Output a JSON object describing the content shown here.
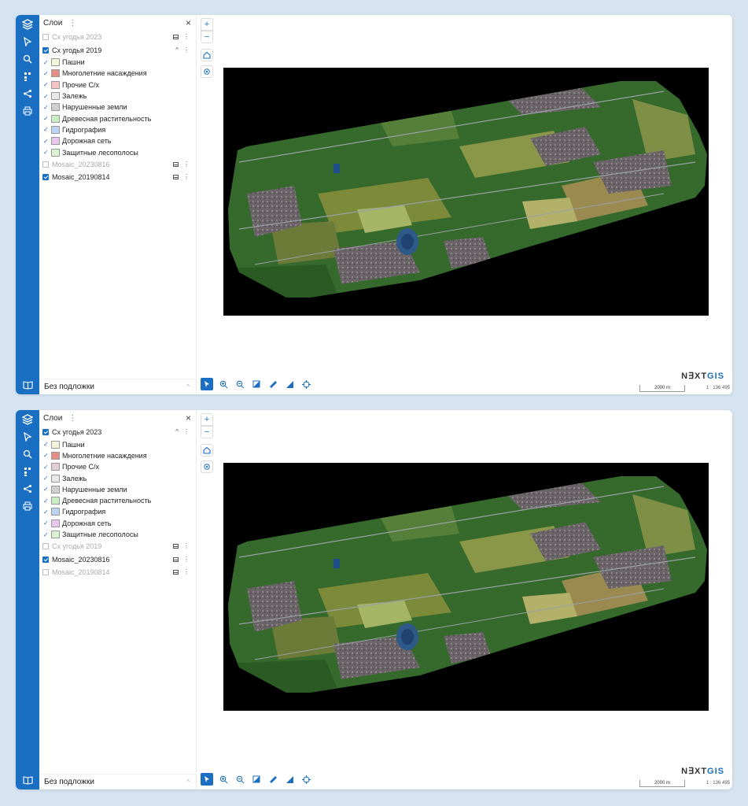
{
  "colors": {
    "accent": "#1a6fc2",
    "rail": "#1a6fc2",
    "map_bg": "#000000"
  },
  "panels": [
    {
      "layers_title": "Слои",
      "rows": [
        {
          "type": "group",
          "label": "Сх угодья 2023",
          "checked": false,
          "dim": true,
          "icons": [
            "table-icon",
            "more-icon"
          ]
        },
        {
          "type": "group",
          "label": "Сх угодья 2019",
          "checked": true,
          "dim": false,
          "icons": [
            "collapse-icon",
            "more-icon"
          ]
        },
        {
          "type": "class",
          "label": "Пашни",
          "color": "#f3f6d8"
        },
        {
          "type": "class",
          "label": "Многолетние насаждения",
          "color": "#e48e86"
        },
        {
          "type": "class",
          "label": "Прочие С/х",
          "color": "#f4c4c4"
        },
        {
          "type": "class",
          "label": "Залежь",
          "color": "#e8e8e8"
        },
        {
          "type": "class",
          "label": "Нарушенные земли",
          "color": "#d8d8d8"
        },
        {
          "type": "class",
          "label": "Древесная растительность",
          "color": "#c7efc2"
        },
        {
          "type": "class",
          "label": "Гидрография",
          "color": "#bcd4f4"
        },
        {
          "type": "class",
          "label": "Дорожная сеть",
          "color": "#e8c6ee"
        },
        {
          "type": "class",
          "label": "Защитные лесополосы",
          "color": "#d8f2d2"
        },
        {
          "type": "group",
          "label": "Mosaic_20230816",
          "checked": false,
          "dim": true,
          "icons": [
            "table-icon",
            "more-icon"
          ]
        },
        {
          "type": "group",
          "label": "Mosaic_20190814",
          "checked": true,
          "dim": false,
          "icons": [
            "table-icon",
            "more-icon"
          ]
        }
      ],
      "basemap": "Без подложки",
      "scale_label": "2000 m",
      "ratio_label": "1 : 136 495",
      "logo_a": "N∃XT",
      "logo_b": "GIS"
    },
    {
      "layers_title": "Слои",
      "rows": [
        {
          "type": "group",
          "label": "Сх угодья 2023",
          "checked": true,
          "dim": false,
          "icons": [
            "collapse-icon",
            "more-icon"
          ]
        },
        {
          "type": "class",
          "label": "Пашни",
          "color": "#f3f6d8"
        },
        {
          "type": "class",
          "label": "Многолетние насаждения",
          "color": "#e48e86"
        },
        {
          "type": "class",
          "label": "Прочие С/х",
          "color": "#e0cfcf"
        },
        {
          "type": "class",
          "label": "Залежь",
          "color": "#e8e8e8"
        },
        {
          "type": "class",
          "label": "Нарушенные земли",
          "color": "#d8d8d8"
        },
        {
          "type": "class",
          "label": "Древесная растительность",
          "color": "#c7efc2"
        },
        {
          "type": "class",
          "label": "Гидрография",
          "color": "#bcd4f4"
        },
        {
          "type": "class",
          "label": "Дорожная сеть",
          "color": "#e8c6ee"
        },
        {
          "type": "class",
          "label": "Защитные лесополосы",
          "color": "#d8f2d2"
        },
        {
          "type": "group",
          "label": "Сх угодья 2019",
          "checked": false,
          "dim": true,
          "icons": [
            "table-icon",
            "more-icon"
          ]
        },
        {
          "type": "group",
          "label": "Mosaic_20230816",
          "checked": true,
          "dim": false,
          "icons": [
            "table-icon",
            "more-icon"
          ]
        },
        {
          "type": "group",
          "label": "Mosaic_20190814",
          "checked": false,
          "dim": true,
          "icons": [
            "table-icon",
            "more-icon"
          ]
        }
      ],
      "basemap": "Без подложки",
      "scale_label": "2000 m",
      "ratio_label": "1 : 136 495",
      "logo_a": "N∃XT",
      "logo_b": "GIS"
    }
  ],
  "zoom_in": "+",
  "zoom_out": "−"
}
